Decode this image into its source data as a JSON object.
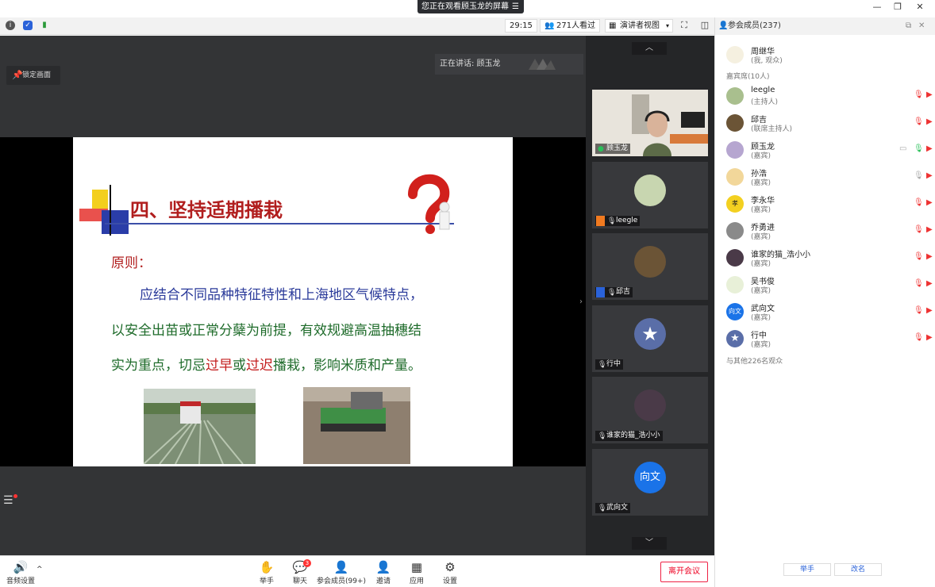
{
  "share_badge": {
    "text": "您正在观看顾玉龙的屏幕"
  },
  "infobar": {
    "timer": "29:15",
    "viewers": "271人看过",
    "view_mode": "演讲者视图"
  },
  "stage": {
    "lock_label": "锁定画面",
    "speaking": "正在讲话: 顾玉龙"
  },
  "slide": {
    "title": "四、坚持适期播栽",
    "principle": "原则：",
    "line1": "应结合不同品种特征特性和上海地区气候特点，",
    "line2": "以安全出苗或正常分蘖为前提，有效规避高温抽穗结",
    "line3_a": "实为重点，切忌",
    "line3_b": "过早",
    "line3_c": "或",
    "line3_d": "过迟",
    "line3_e": "播栽，影响米质和产量。"
  },
  "thumbs": [
    {
      "label": "顾玉龙"
    },
    {
      "label": "leegle"
    },
    {
      "label": "邱吉"
    },
    {
      "label": "行中"
    },
    {
      "label": "谁家的猫_浩小小"
    },
    {
      "label": "武向文",
      "avatar_text": "向文"
    }
  ],
  "toolbar": {
    "audio": "音频设置",
    "raise": "举手",
    "chat": "聊天",
    "chat_badge": "3",
    "members": "参会成员(99+)",
    "invite": "邀请",
    "apps": "应用",
    "settings": "设置",
    "leave": "离开会议"
  },
  "panel": {
    "title": "参会成员(237)",
    "me_name": "周继华",
    "me_role": "(我, 观众)",
    "guest_section": "嘉宾席(10人)",
    "members": [
      {
        "name": "leegle",
        "role": "(主持人)"
      },
      {
        "name": "邱吉",
        "role": "(联席主持人)"
      },
      {
        "name": "顾玉龙",
        "role": "(嘉宾)"
      },
      {
        "name": "孙浩",
        "role": "(嘉宾)"
      },
      {
        "name": "李永华",
        "role": "(嘉宾)"
      },
      {
        "name": "乔勇进",
        "role": "(嘉宾)"
      },
      {
        "name": "谁家的猫_浩小小",
        "role": "(嘉宾)"
      },
      {
        "name": "吴书俊",
        "role": "(嘉宾)"
      },
      {
        "name": "武向文",
        "role": "(嘉宾)",
        "avatar_text": "向文"
      },
      {
        "name": "行中",
        "role": "(嘉宾)"
      }
    ],
    "others": "与其他226名观众",
    "raise_btn": "举手",
    "rename_btn": "改名"
  }
}
